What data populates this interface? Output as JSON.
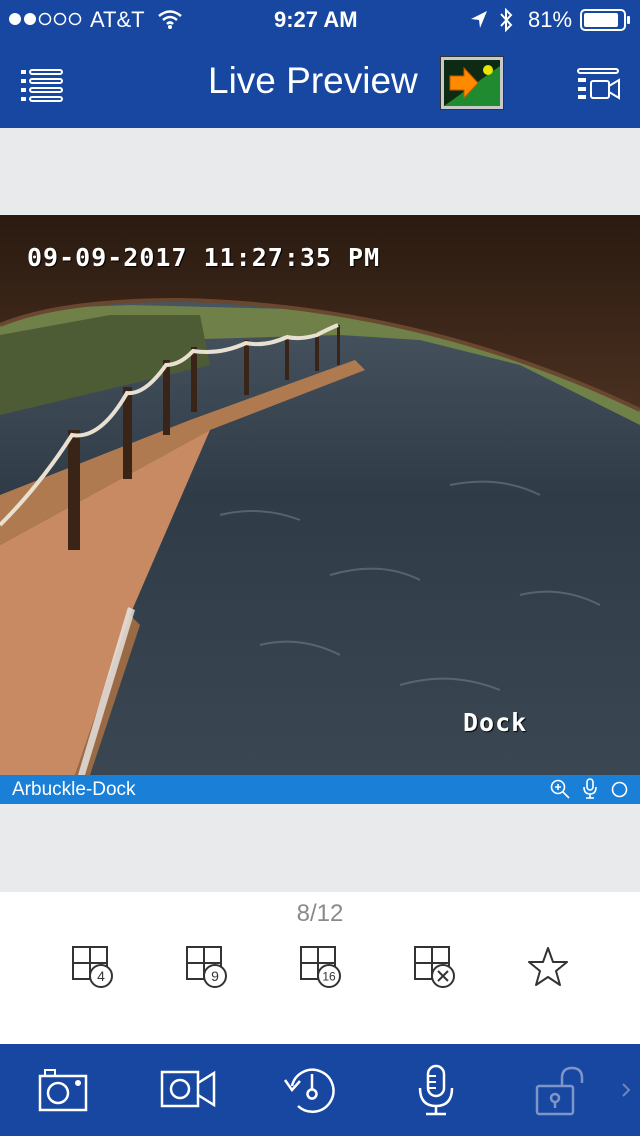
{
  "status": {
    "carrier": "AT&T",
    "time": "9:27 AM",
    "battery": "81%"
  },
  "header": {
    "title": "Live Preview",
    "menu_icon": "list-icon",
    "device_icon": "device-list-icon"
  },
  "video": {
    "timestamp": "09-09-2017 11:27:35 PM",
    "overlay_label": "Dock",
    "camera_name": "Arbuckle-Dock"
  },
  "layout": {
    "page_indicator": "8/12",
    "options": [
      {
        "value": "4",
        "icon": "grid-4-icon"
      },
      {
        "value": "9",
        "icon": "grid-9-icon"
      },
      {
        "value": "16",
        "icon": "grid-16-icon"
      },
      {
        "icon": "grid-close-icon"
      },
      {
        "icon": "star-icon"
      }
    ]
  },
  "toolbar": {
    "items": [
      "camera-snapshot-icon",
      "record-video-icon",
      "playback-icon",
      "microphone-icon",
      "unlock-icon"
    ]
  },
  "colors": {
    "brand": "#1747a0",
    "camera_bar": "#1a7fd6",
    "background": "#e8eaeb"
  }
}
